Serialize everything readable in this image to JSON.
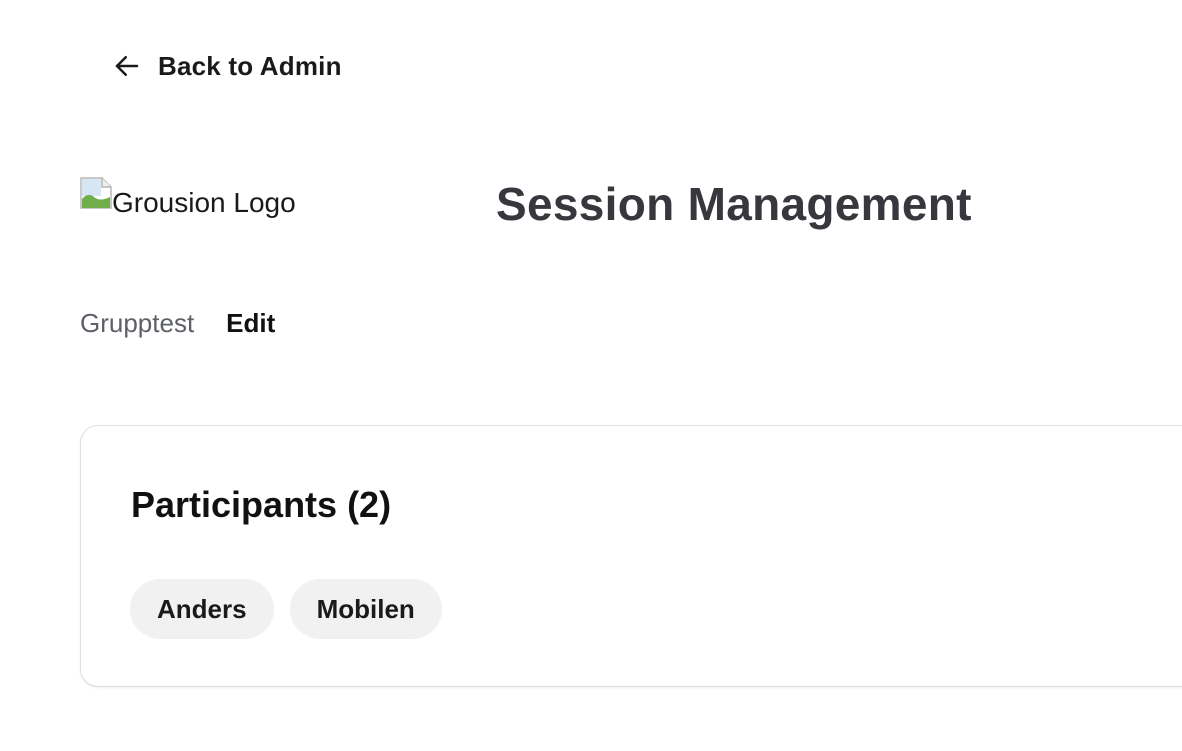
{
  "nav": {
    "back_label": "Back to Admin",
    "back_icon": "arrow-left-icon"
  },
  "header": {
    "logo_alt": "Grousion Logo",
    "title": "Session Management"
  },
  "session": {
    "name": "Grupptest",
    "edit_label": "Edit"
  },
  "participants": {
    "title": "Participants (2)",
    "items": [
      {
        "name": "Anders"
      },
      {
        "name": "Mobilen"
      }
    ]
  },
  "colors": {
    "title": "#38373d",
    "session_name": "#5d6066",
    "chip_bg": "#f1f1f1",
    "card_border": "#dedede"
  }
}
